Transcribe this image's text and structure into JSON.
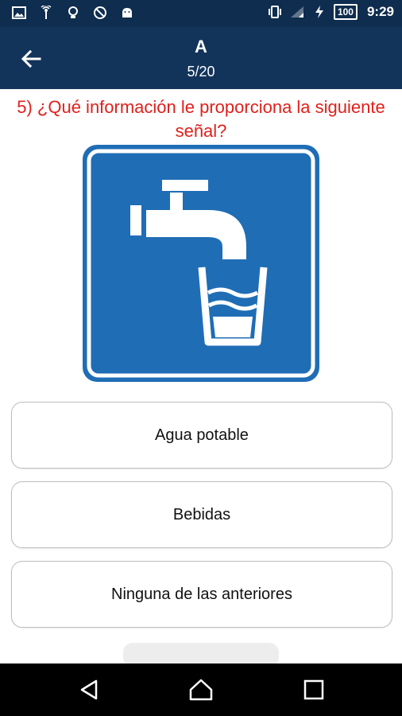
{
  "status_bar": {
    "icons": [
      "image-icon",
      "signal-tower-icon",
      "lightbulb-icon",
      "blocked-icon",
      "android-icon",
      "vibrate-icon",
      "wifi-off-icon",
      "charging-icon"
    ],
    "battery": "100",
    "time": "9:29"
  },
  "app_bar": {
    "title": "A",
    "progress": "5/20"
  },
  "question": {
    "text": "5) ¿Qué información le proporciona la siguiente señal?",
    "color": "#e0201b"
  },
  "sign": {
    "image": "drinking-water-sign",
    "background_color": "#1f6db5"
  },
  "answers": [
    {
      "label": "Agua potable"
    },
    {
      "label": "Bebidas"
    },
    {
      "label": "Ninguna de las anteriores"
    }
  ],
  "colors": {
    "app_bar": "#13345a",
    "status_bar": "#0e2d4f"
  }
}
